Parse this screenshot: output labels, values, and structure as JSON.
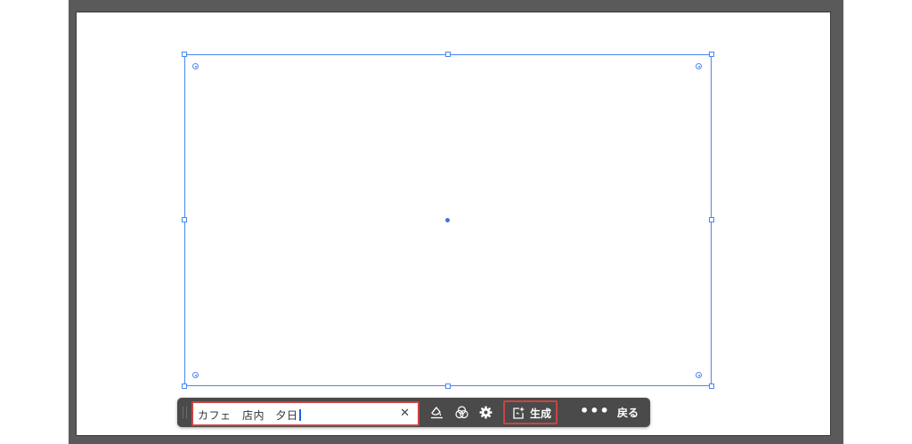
{
  "taskbar": {
    "prompt": {
      "value": "カフェ　店内　夕日",
      "clear_icon": "close-icon"
    },
    "tools": [
      {
        "name": "fill-style-icon"
      },
      {
        "name": "color-mix-icon"
      },
      {
        "name": "gear-icon"
      }
    ],
    "generate_label": "生成",
    "generate_icon": "sparkle-frame-icon",
    "more_label": "•••",
    "back_label": "戻る"
  },
  "colors": {
    "selection": "#4a86f0",
    "highlight_border": "#c94545",
    "taskbar_bg": "#4a4a4a",
    "frame_bg": "#5a5a5a"
  }
}
